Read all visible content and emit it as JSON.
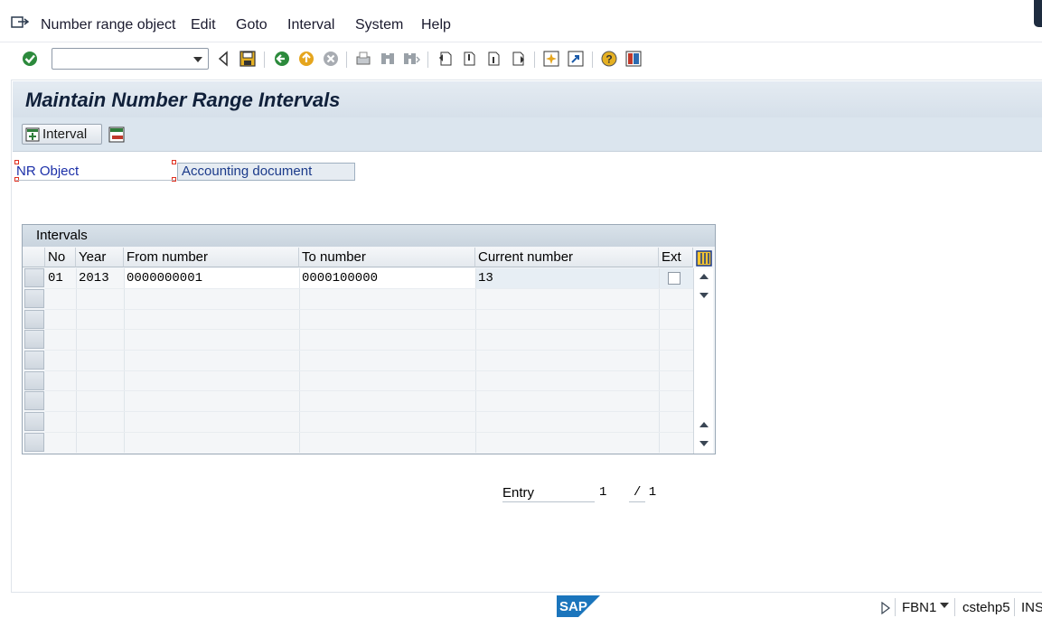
{
  "menu": {
    "items": [
      "Number range object",
      "Edit",
      "Goto",
      "Interval",
      "System",
      "Help"
    ]
  },
  "toolbar": {
    "command_value": "",
    "icons": [
      "enter-icon",
      "back-icon",
      "save-icon",
      "back-nav-icon",
      "exit-icon",
      "cancel-icon",
      "print-icon",
      "find-icon",
      "find-next-icon",
      "first-page-icon",
      "previous-page-icon",
      "next-page-icon",
      "last-page-icon",
      "new-session-icon",
      "shortcut-icon",
      "help-icon",
      "layout-icon"
    ]
  },
  "page": {
    "title": "Maintain Number Range Intervals",
    "interval_button": "Interval",
    "nr_object_label": "NR Object",
    "nr_object_value": "Accounting document"
  },
  "intervals": {
    "heading": "Intervals",
    "columns": [
      "No",
      "Year",
      "From number",
      "To number",
      "Current number",
      "Ext"
    ],
    "rows": [
      {
        "no": "01",
        "year": "2013",
        "from": "0000000001",
        "to": "0000100000",
        "current": "13",
        "ext": false
      }
    ]
  },
  "entry": {
    "label": "Entry",
    "current": "1",
    "total": "/ 1"
  },
  "status": {
    "logo": "SAP",
    "transaction": "FBN1",
    "server": "cstehp5",
    "mode": "INS"
  },
  "colors": {
    "title_bar": "#d6e0ea",
    "label_blue": "#1b2fa8",
    "field_bg": "#e6ecf2"
  }
}
